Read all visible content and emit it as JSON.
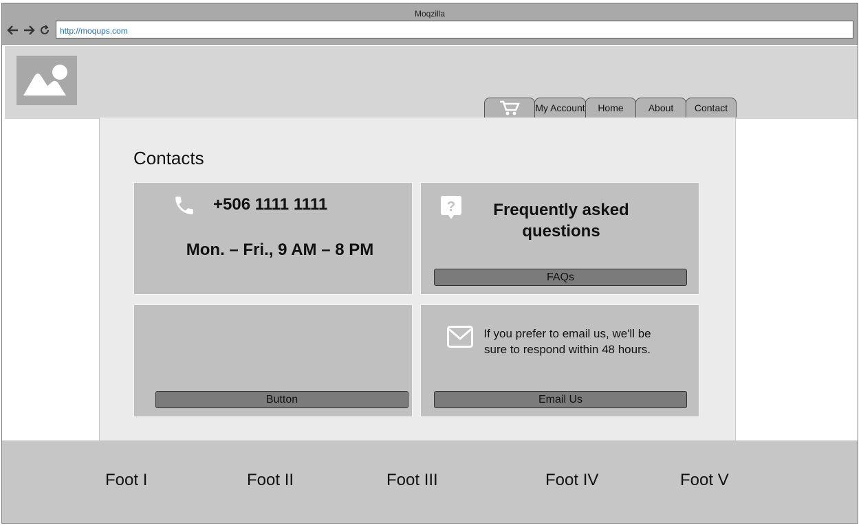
{
  "window": {
    "title": "Moqzilla",
    "url": "http://moqups.com"
  },
  "nav_tabs": [
    {
      "icon": "cart-icon"
    },
    {
      "label": "My Account"
    },
    {
      "label": "Home"
    },
    {
      "label": "About"
    },
    {
      "label": "Contact"
    }
  ],
  "main": {
    "title": "Contacts",
    "phone_card": {
      "phone": "+506 1111 1111",
      "hours": "Mon. – Fri., 9 AM – 8 PM",
      "icon": "phone-icon"
    },
    "faq_card": {
      "heading": "Frequently asked questions",
      "button": "FAQs",
      "icon": "question-bubble-icon"
    },
    "blank_card": {
      "button": "Button"
    },
    "email_card": {
      "text": "If you prefer to email us, we'll be sure to respond within 48 hours.",
      "button": "Email Us",
      "icon": "envelope-icon"
    }
  },
  "footer": {
    "links": [
      "Foot I",
      "Foot II",
      "Foot III",
      "Foot IV",
      "Foot V"
    ]
  },
  "colors": {
    "header_bg": "#d6d6d6",
    "content_bg": "#ebebeb",
    "card_bg": "#c0c0c0",
    "button_bg": "#7b7b7b",
    "footer_bg": "#c6c6c6"
  }
}
